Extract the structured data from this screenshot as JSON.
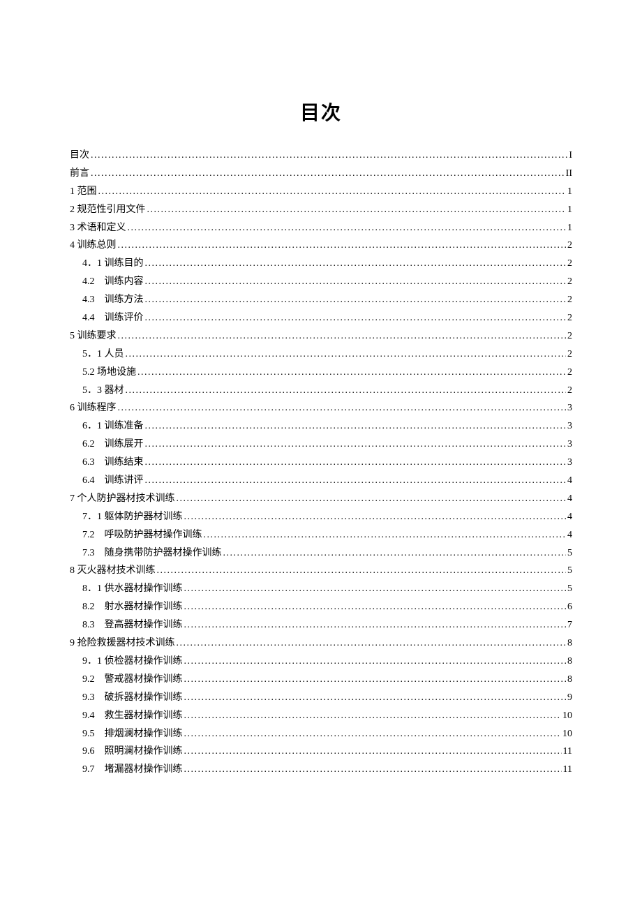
{
  "title": "目次",
  "entries": [
    {
      "level": 1,
      "label": "目次",
      "page": "I"
    },
    {
      "level": 1,
      "label": "前言",
      "page": "II"
    },
    {
      "level": 1,
      "label": "1 范围",
      "page": "1"
    },
    {
      "level": 1,
      "label": "2 规范性引用文件",
      "page": "1"
    },
    {
      "level": 1,
      "label": "3 术语和定义",
      "page": "1"
    },
    {
      "level": 1,
      "label": "4 训练总则",
      "page": "2"
    },
    {
      "level": 2,
      "label": "4．1 训练目的",
      "page": "2"
    },
    {
      "level": 2,
      "label": "4.2　训练内容",
      "page": "2"
    },
    {
      "level": 2,
      "label": "4.3　训练方法",
      "page": "2"
    },
    {
      "level": 2,
      "label": "4.4　训练评价",
      "page": "2"
    },
    {
      "level": 1,
      "label": "5 训练要求",
      "page": "2"
    },
    {
      "level": 2,
      "label": "5．1 人员",
      "page": "2"
    },
    {
      "level": 2,
      "label": "5.2 场地设施",
      "page": "2"
    },
    {
      "level": 2,
      "label": "5．3 器材",
      "page": "2"
    },
    {
      "level": 1,
      "label": "6 训练程序",
      "page": "3"
    },
    {
      "level": 2,
      "label": "6．1 训练准备",
      "page": "3"
    },
    {
      "level": 2,
      "label": "6.2　训练展开",
      "page": "3"
    },
    {
      "level": 2,
      "label": "6.3　训练结束",
      "page": "3"
    },
    {
      "level": 2,
      "label": "6.4　训练讲评",
      "page": "4"
    },
    {
      "level": 1,
      "label": "7 个人防护器材技术训练",
      "page": "4"
    },
    {
      "level": 2,
      "label": "7．1 躯体防护器材训练",
      "page": "4"
    },
    {
      "level": 2,
      "label": "7.2　呼吸防护器材操作训练",
      "page": "4"
    },
    {
      "level": 2,
      "label": "7.3　随身携带防护器材操作训练",
      "page": "5"
    },
    {
      "level": 1,
      "label": "8 灭火器材技术训练",
      "page": "5"
    },
    {
      "level": 2,
      "label": "8．1 供水器材操作训练",
      "page": "5"
    },
    {
      "level": 2,
      "label": "8.2　射水器材操作训练",
      "page": "6"
    },
    {
      "level": 2,
      "label": "8.3　登高器材操作训练",
      "page": "7"
    },
    {
      "level": 1,
      "label": "9 抢险救援器材技术训练",
      "page": "8"
    },
    {
      "level": 2,
      "label": "9．1 侦检器材操作训练",
      "page": "8"
    },
    {
      "level": 2,
      "label": "9.2　警戒器材操作训练",
      "page": "8"
    },
    {
      "level": 2,
      "label": "9.3　破拆器材操作训练",
      "page": "9"
    },
    {
      "level": 2,
      "label": "9.4　救生器材操作训练",
      "page": "10"
    },
    {
      "level": 2,
      "label": "9.5　排烟澜材操作训练",
      "page": "10"
    },
    {
      "level": 2,
      "label": "9.6　照明澜材操作训练",
      "page": "11"
    },
    {
      "level": 2,
      "label": "9.7　堵漏器材操作训练",
      "page": "11"
    }
  ]
}
